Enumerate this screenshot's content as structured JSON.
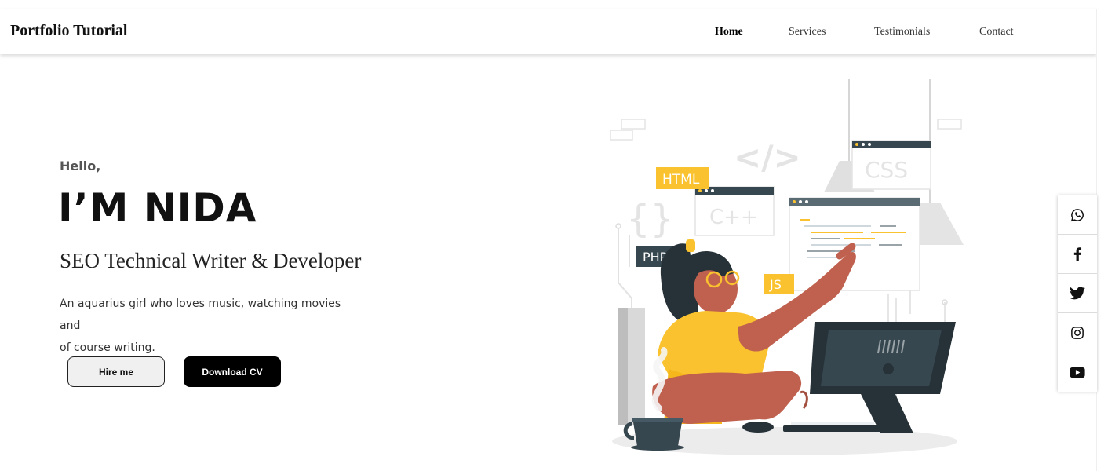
{
  "header": {
    "brand": "Portfolio Tutorial",
    "nav": [
      {
        "label": "Home"
      },
      {
        "label": "Services"
      },
      {
        "label": "Testimonials"
      },
      {
        "label": "Contact"
      }
    ]
  },
  "hero": {
    "greeting": "Hello,",
    "name": "I’M NIDA",
    "role": "SEO Technical Writer & Developer",
    "bio_line1": "An aquarius girl who loves music, watching movies and",
    "bio_line2": "of course writing.",
    "hire_label": "Hire me",
    "download_label": "Download CV"
  },
  "illustration": {
    "tags": [
      "HTML",
      "PHP",
      "JS",
      "C++",
      "CSS",
      "</>",
      "{}"
    ]
  },
  "social": [
    {
      "icon": "whatsapp-icon"
    },
    {
      "icon": "facebook-icon"
    },
    {
      "icon": "twitter-icon"
    },
    {
      "icon": "instagram-icon"
    },
    {
      "icon": "youtube-icon"
    }
  ],
  "colors": {
    "accent_yellow": "#f9c22e",
    "dark_slate": "#37474f",
    "skin": "#c0614f",
    "black": "#000000"
  }
}
